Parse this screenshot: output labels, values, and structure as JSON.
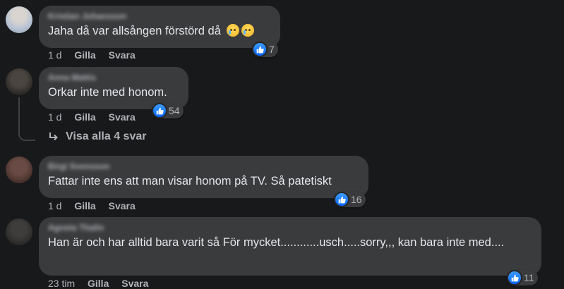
{
  "colors": {
    "background": "#18191a",
    "bubble": "#3a3b3c",
    "text": "#e4e6eb",
    "secondary_text": "#b0b3b8",
    "like_blue": "#0866ff"
  },
  "comments": [
    {
      "author": "Kristian Johansson",
      "text": "Jaha då var allsången förstörd då",
      "emoji": [
        "crying-face-icon",
        "crying-face-icon"
      ],
      "time": "1 d",
      "like_label": "Gilla",
      "reply_label": "Svara",
      "reaction_icon": "thumbs-up-icon",
      "reaction_count": "7"
    },
    {
      "author": "Anna Mattis",
      "text": "Orkar inte med honom.",
      "time": "1 d",
      "like_label": "Gilla",
      "reply_label": "Svara",
      "reaction_icon": "thumbs-up-icon",
      "reaction_count": "54",
      "view_replies_label": "Visa alla 4 svar"
    },
    {
      "author": "Birgi Svensson",
      "text": "Fattar inte ens att man visar honom på TV. Så patetiskt",
      "time": "1 d",
      "like_label": "Gilla",
      "reply_label": "Svara",
      "reaction_icon": "thumbs-up-icon",
      "reaction_count": "16"
    },
    {
      "author": "Agneta Thalin",
      "text": "Han är och har alltid bara varit så För mycket............usch.....sorry,,, kan bara inte med....",
      "time": "23 tim",
      "like_label": "Gilla",
      "reply_label": "Svara",
      "reaction_icon": "thumbs-up-icon",
      "reaction_count": "11"
    }
  ]
}
